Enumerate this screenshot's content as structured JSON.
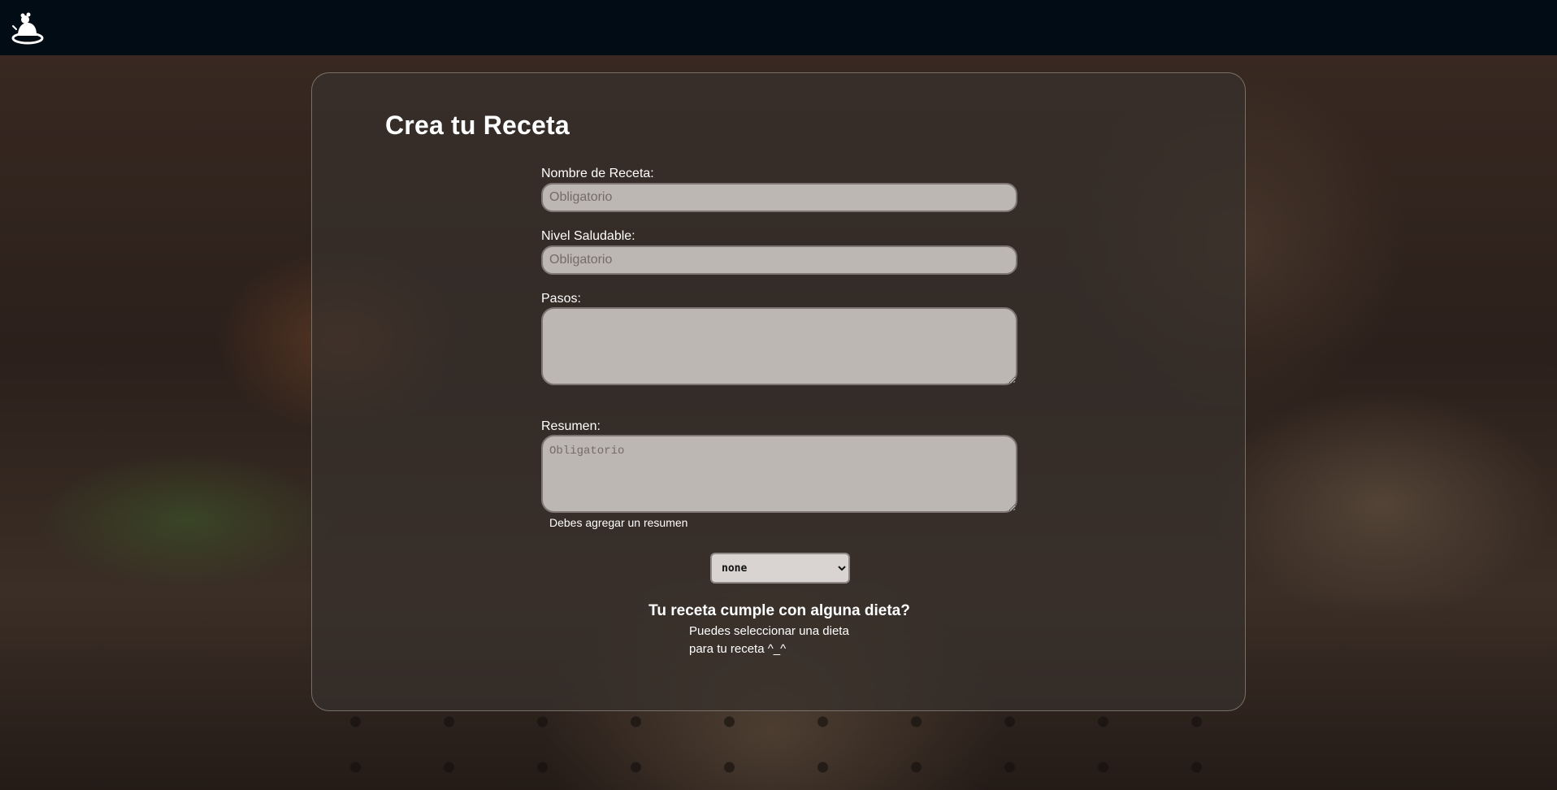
{
  "header": {
    "logo_icon": "chef-rat-logo-icon"
  },
  "form": {
    "title": "Crea tu Receta",
    "name_label": "Nombre de Receta:",
    "name_placeholder": "Obligatorio",
    "name_value": "",
    "health_label": "Nivel Saludable:",
    "health_placeholder": "Obligatorio",
    "health_value": "",
    "steps_label": "Pasos:",
    "steps_value": "",
    "summary_label": "Resumen:",
    "summary_placeholder": "Obligatorio",
    "summary_value": "",
    "summary_error": "Debes agregar un resumen",
    "diet_select": {
      "selected": "none",
      "options": [
        "none"
      ]
    },
    "diet_title": "Tu receta cumple con alguna dieta?",
    "diet_desc_line1": "Puedes seleccionar una dieta",
    "diet_desc_line2": "para tu receta ^_^"
  },
  "colors": {
    "topbar": "#020c14",
    "field_bg": "#bdb7b3",
    "text": "#ffffff"
  }
}
